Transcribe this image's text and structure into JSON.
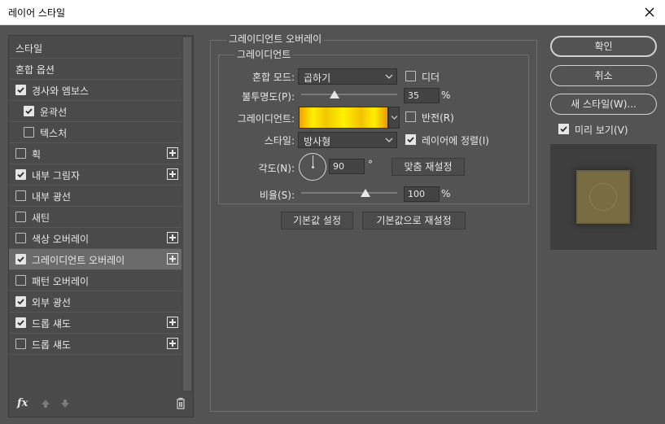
{
  "window": {
    "title": "레이어 스타일"
  },
  "left_panel": {
    "items": [
      {
        "label": "스타일",
        "checkbox": false,
        "checked": false,
        "plus": false,
        "selected": false
      },
      {
        "label": "혼합 옵션",
        "checkbox": false,
        "checked": false,
        "plus": false,
        "selected": false
      },
      {
        "label": "경사와 엠보스",
        "checkbox": true,
        "checked": true,
        "plus": false,
        "selected": false
      },
      {
        "label": "윤곽선",
        "checkbox": true,
        "checked": true,
        "plus": false,
        "selected": false,
        "indent": true
      },
      {
        "label": "텍스처",
        "checkbox": true,
        "checked": false,
        "plus": false,
        "selected": false,
        "indent": true
      },
      {
        "label": "획",
        "checkbox": true,
        "checked": false,
        "plus": true,
        "selected": false
      },
      {
        "label": "내부 그림자",
        "checkbox": true,
        "checked": true,
        "plus": true,
        "selected": false
      },
      {
        "label": "내부 광선",
        "checkbox": true,
        "checked": false,
        "plus": false,
        "selected": false
      },
      {
        "label": "새틴",
        "checkbox": true,
        "checked": false,
        "plus": false,
        "selected": false
      },
      {
        "label": "색상 오버레이",
        "checkbox": true,
        "checked": false,
        "plus": true,
        "selected": false
      },
      {
        "label": "그레이디언트 오버레이",
        "checkbox": true,
        "checked": true,
        "plus": true,
        "selected": true
      },
      {
        "label": "패턴 오버레이",
        "checkbox": true,
        "checked": false,
        "plus": false,
        "selected": false
      },
      {
        "label": "외부 광선",
        "checkbox": true,
        "checked": true,
        "plus": false,
        "selected": false
      },
      {
        "label": "드롭 섀도",
        "checkbox": true,
        "checked": true,
        "plus": true,
        "selected": false
      },
      {
        "label": "드롭 섀도",
        "checkbox": true,
        "checked": false,
        "plus": true,
        "selected": false
      }
    ],
    "fx_label": "fx"
  },
  "panel": {
    "group_title": "그레이디언트 오버레이",
    "subgroup_title": "그레이디언트",
    "blend_mode_label": "혼합 모드:",
    "blend_mode_value": "곱하기",
    "dither_label": "디더",
    "dither_checked": false,
    "opacity_label": "불투명도(P):",
    "opacity_value": "35",
    "opacity_percent": 35,
    "opacity_unit": "%",
    "gradient_label": "그레이디언트:",
    "reverse_label": "반전(R)",
    "reverse_checked": false,
    "style_label": "스타일:",
    "style_value": "방사형",
    "align_label": "레이어에 정렬(I)",
    "align_checked": true,
    "angle_label": "각도(N):",
    "angle_value": "90",
    "angle_unit": "°",
    "reset_alignment_label": "맞춤 재설정",
    "scale_label": "비율(S):",
    "scale_value": "100",
    "scale_percent": 100,
    "scale_unit": "%",
    "make_default_label": "기본값 설정",
    "reset_default_label": "기본값으로 재설정"
  },
  "buttons": {
    "ok": "확인",
    "cancel": "취소",
    "new_style": "새 스타일(W)...",
    "preview_label": "미리 보기(V)",
    "preview_checked": true
  },
  "colors": {
    "background": "#535353",
    "preview_swatch": "#776c42",
    "gradient_yellow": "#fff000",
    "gradient_orange": "#f0a000"
  }
}
